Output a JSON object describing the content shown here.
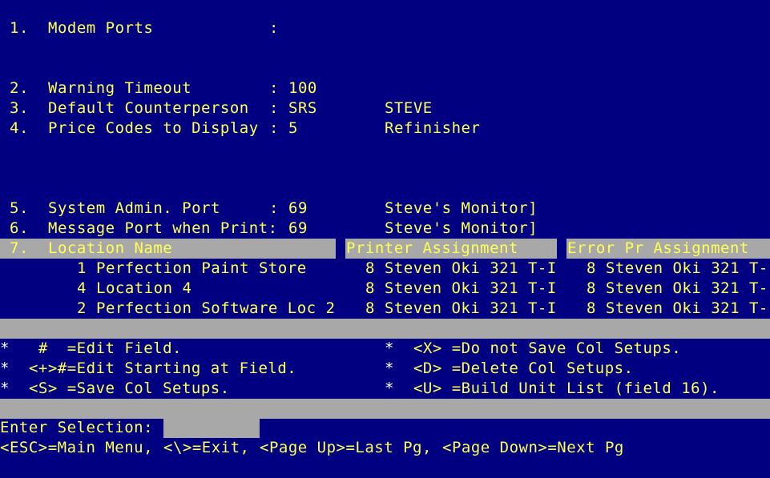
{
  "settings": {
    "modem_ports": {
      "num": "1.",
      "label": "Modem Ports",
      "sep": ":"
    },
    "warning_timeout": {
      "num": "2.",
      "label": "Warning Timeout",
      "sep": ":",
      "value": "100"
    },
    "default_counterperson": {
      "num": "3.",
      "label": "Default Counterperson",
      "sep": ":",
      "value": "SRS",
      "desc": "STEVE"
    },
    "price_codes": {
      "num": "4.",
      "label": "Price Codes to Display",
      "sep": ":",
      "value": "5",
      "desc": "Refinisher"
    },
    "system_admin_port": {
      "num": "5.",
      "label": "System Admin. Port",
      "sep": ":",
      "value": "69",
      "desc": "Steve's Monitor]"
    },
    "message_port": {
      "num": "6.",
      "label": "Message Port when Print:",
      "value": "69",
      "desc": "Steve's Monitor]"
    }
  },
  "location_table": {
    "num": "7.",
    "headers": {
      "location": "Location Name",
      "printer": "Printer Assignment",
      "error_printer": "Error Pr Assignment"
    },
    "rows": [
      {
        "id": "1",
        "name": "Perfection Paint Store",
        "printer": "8 Steven Oki 321 T-I",
        "error_printer": "8 Steven Oki 321 T-"
      },
      {
        "id": "4",
        "name": "Location 4",
        "printer": "8 Steven Oki 321 T-I",
        "error_printer": "8 Steven Oki 321 T-"
      },
      {
        "id": "2",
        "name": "Perfection Software Loc 2",
        "printer": "8 Steven Oki 321 T-I",
        "error_printer": "8 Steven Oki 321 T-"
      }
    ]
  },
  "help": {
    "left": [
      {
        "star": "*",
        "text": "  #  =Edit Field."
      },
      {
        "star": "*",
        "text": " <+>#=Edit Starting at Field."
      },
      {
        "star": "*",
        "text": " <S> =Save Col Setups."
      }
    ],
    "right": [
      {
        "star": "*",
        "text": " <X> =Do not Save Col Setups."
      },
      {
        "star": "*",
        "text": " <D> =Delete Col Setups."
      },
      {
        "star": "*",
        "text": " <U> =Build Unit List (field 16)."
      }
    ]
  },
  "prompt": {
    "label": "Enter Selection:",
    "value": ""
  },
  "footer": {
    "esc": "<ESC>=Main Menu,",
    "exit": "<\\>=Exit,",
    "page_up": "<Page Up>=Last Pg,",
    "page_down": "<Page Down>=Next Pg"
  },
  "colors": {
    "background": "#000080",
    "text": "#FFFF55",
    "highlight": "#A8A8A8",
    "white": "#FFFFFF"
  }
}
